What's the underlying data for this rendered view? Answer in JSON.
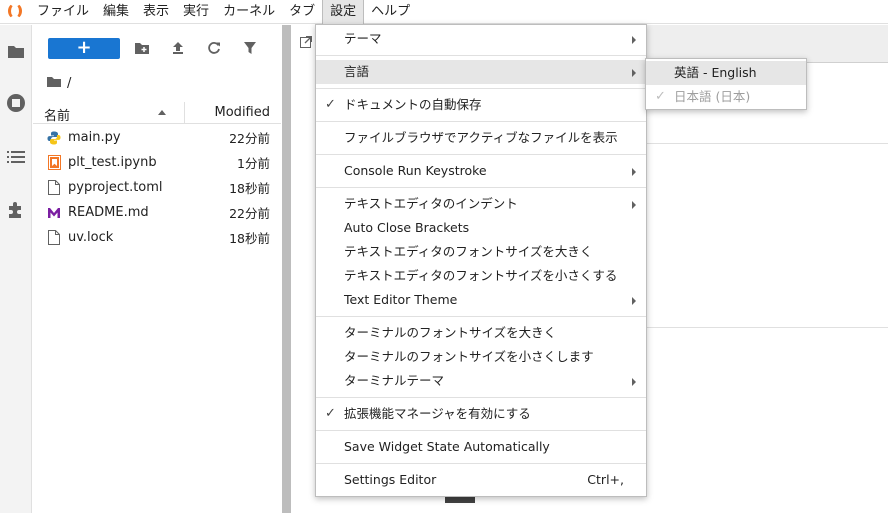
{
  "menubar": {
    "items": [
      "ファイル",
      "編集",
      "表示",
      "実行",
      "カーネル",
      "タブ",
      "設定",
      "ヘルプ"
    ],
    "active_index": 6
  },
  "sidebar": {
    "icons": [
      "folder-icon",
      "running-icon",
      "toc-icon",
      "extension-icon"
    ]
  },
  "filebrowser": {
    "new_label": "+",
    "breadcrumb": "/",
    "col_name": "名前",
    "col_modified": "Modified",
    "files": [
      {
        "name": "main.py",
        "modified": "22分前",
        "icon": "python-file-icon"
      },
      {
        "name": "plt_test.ipynb",
        "modified": "1分前",
        "icon": "notebook-file-icon"
      },
      {
        "name": "pyproject.toml",
        "modified": "18秒前",
        "icon": "file-icon"
      },
      {
        "name": "README.md",
        "modified": "22分前",
        "icon": "markdown-file-icon"
      },
      {
        "name": "uv.lock",
        "modified": "18秒前",
        "icon": "file-icon"
      }
    ]
  },
  "settings_menu": {
    "theme": "テーマ",
    "language": "言語",
    "autosave": "ドキュメントの自動保存",
    "show_active": "ファイルブラウザでアクティブなファイルを表示",
    "console_keystroke": "Console Run Keystroke",
    "editor_indent": "テキストエディタのインデント",
    "auto_close": "Auto Close Brackets",
    "editor_font_up": "テキストエディタのフォントサイズを大きく",
    "editor_font_down": "テキストエディタのフォントサイズを小さくする",
    "editor_theme": "Text Editor Theme",
    "term_font_up": "ターミナルのフォントサイズを大きく",
    "term_font_down": "ターミナルのフォントサイズを小さくします",
    "term_theme": "ターミナルテーマ",
    "ext_manager": "拡張機能マネージャを有効にする",
    "widget_state": "Save Widget State Automatically",
    "settings_editor": "Settings Editor",
    "settings_editor_shortcut": "Ctrl+,",
    "check_mark": "✓"
  },
  "language_submenu": {
    "english": "英語 - English",
    "japanese": "日本語 (日本)"
  },
  "colors": {
    "accent": "#1976d2",
    "jupyter_orange": "#f37726"
  }
}
